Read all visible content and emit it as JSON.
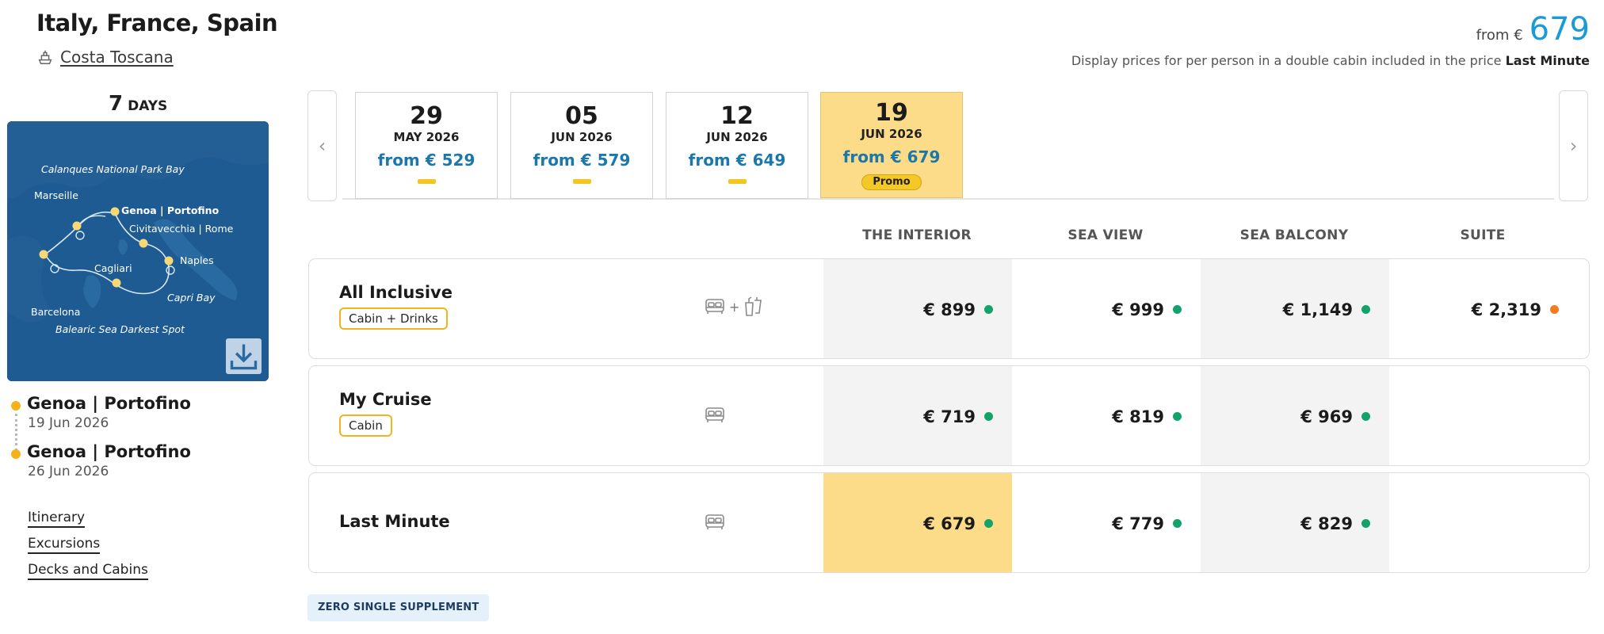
{
  "header": {
    "title": "Italy, France, Spain",
    "ship_name": "Costa Toscana",
    "from_label": "from €",
    "price": "679",
    "disclaimer_prefix": "Display prices for per person in a double cabin included in the price",
    "disclaimer_fare": "Last Minute"
  },
  "duration": {
    "number": "7",
    "unit": "DAYS"
  },
  "map": {
    "icon": "download-icon",
    "labels": {
      "calanques": "Calanques National Park Bay",
      "marseille": "Marseille",
      "genoa": "Genoa | Portofino",
      "civitavecchia": "Civitavecchia | Rome",
      "cagliari": "Cagliari",
      "naples": "Naples",
      "capri": "Capri Bay",
      "barcelona": "Barcelona",
      "balearic": "Balearic Sea Darkest Spot"
    }
  },
  "departure": {
    "port": "Genoa | Portofino",
    "date": "19 Jun 2026"
  },
  "arrival": {
    "port": "Genoa | Portofino",
    "date": "26 Jun 2026"
  },
  "side_links": [
    "Itinerary",
    "Excursions",
    "Decks and Cabins"
  ],
  "dates": [
    {
      "day": "29",
      "month": "MAY 2026",
      "price": "from € 529",
      "active": false,
      "promo": ""
    },
    {
      "day": "05",
      "month": "JUN 2026",
      "price": "from € 579",
      "active": false,
      "promo": ""
    },
    {
      "day": "12",
      "month": "JUN 2026",
      "price": "from € 649",
      "active": false,
      "promo": ""
    },
    {
      "day": "19",
      "month": "JUN 2026",
      "price": "from € 679",
      "active": true,
      "promo": "Promo"
    }
  ],
  "columns": [
    "THE INTERIOR",
    "SEA VIEW",
    "SEA BALCONY",
    "SUITE"
  ],
  "fares": [
    {
      "name": "All Inclusive",
      "badge": "Cabin + Drinks",
      "icons": [
        "bed-icon",
        "drinks-icon"
      ],
      "prices": [
        "€ 899",
        "€ 999",
        "€ 1,149",
        "€ 2,319"
      ],
      "availability": [
        "green",
        "green",
        "green",
        "orange"
      ]
    },
    {
      "name": "My Cruise",
      "badge": "Cabin",
      "icons": [
        "bed-icon"
      ],
      "prices": [
        "€ 719",
        "€ 819",
        "€ 969",
        ""
      ],
      "availability": [
        "green",
        "green",
        "green",
        ""
      ]
    },
    {
      "name": "Last Minute",
      "badge": "",
      "icons": [
        "bed-icon"
      ],
      "prices": [
        "€ 679",
        "€ 779",
        "€ 829",
        ""
      ],
      "availability": [
        "green",
        "green",
        "green",
        ""
      ]
    }
  ],
  "colors": {
    "green": "#12a36b",
    "orange": "#f27c1e",
    "selected": "#fcdb89",
    "accent": "#1a9ad6"
  },
  "zero_supplement": "ZERO SINGLE SUPPLEMENT"
}
